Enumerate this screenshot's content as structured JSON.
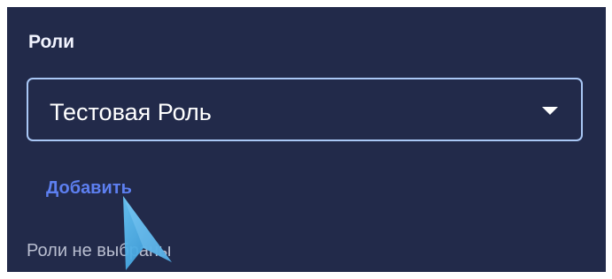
{
  "roles_section": {
    "title": "Роли",
    "select": {
      "value": "Тестовая Роль"
    },
    "add_label": "Добавить",
    "empty_message": "Роли не выбраны"
  },
  "colors": {
    "panel_background": "#222a4a",
    "field_border": "#a9c7f5",
    "link": "#5d7ff0",
    "cursor": "#4aa8e0"
  },
  "icons": {
    "dropdown": "chevron-down-icon",
    "cursor": "cursor-arrow-icon"
  }
}
